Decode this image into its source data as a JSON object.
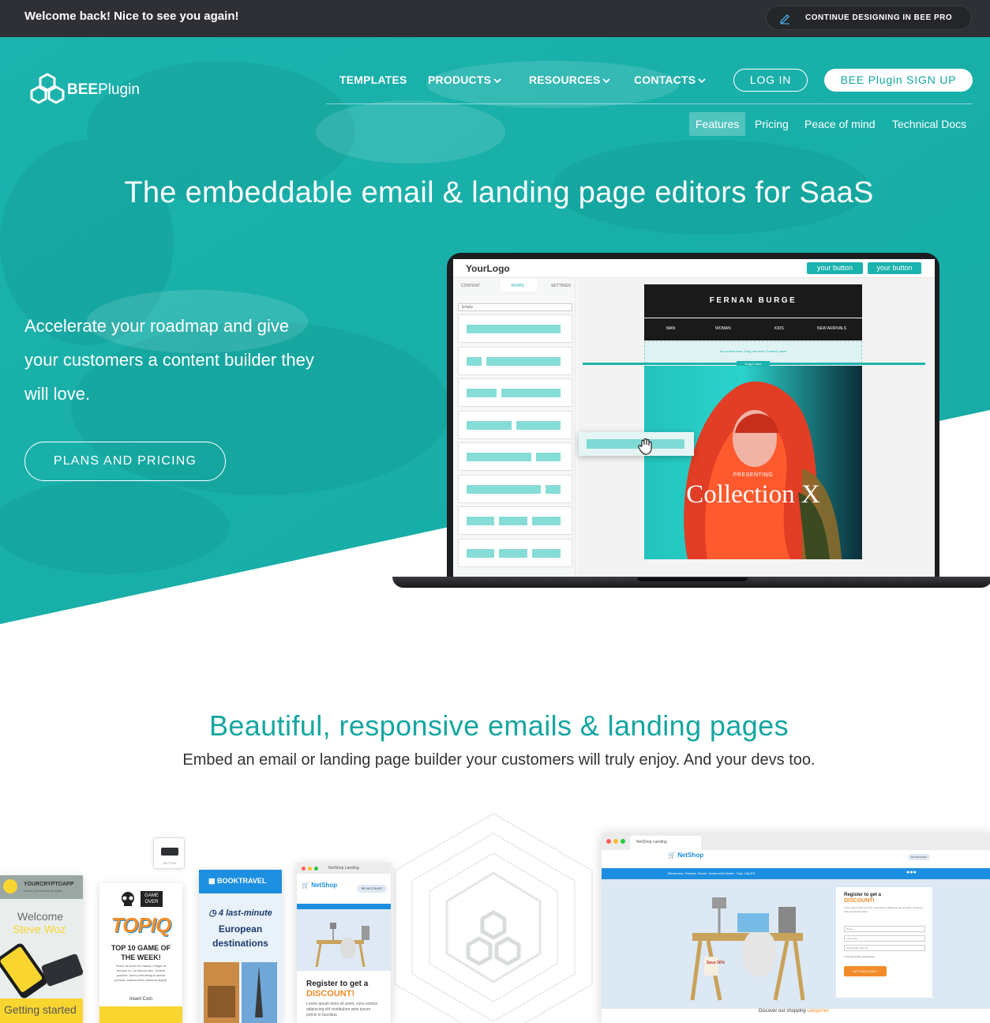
{
  "topbar": {
    "welcome": "Welcome back! Nice to see you again!",
    "continue_label": "CONTINUE DESIGNING IN BEE PRO"
  },
  "brand": {
    "logo_bold": "BEE",
    "logo_light": "Plugin"
  },
  "nav": {
    "items": [
      {
        "label": "TEMPLATES"
      },
      {
        "label": "PRODUCTS"
      },
      {
        "label": "RESOURCES"
      },
      {
        "label": "CONTACTS"
      }
    ],
    "login": "LOG IN",
    "signup": "BEE Plugin SIGN UP"
  },
  "subnav": [
    "Features",
    "Pricing",
    "Peace of mind",
    "Technical Docs"
  ],
  "hero": {
    "title": "The embeddable email & landing page editors for SaaS",
    "description": "Accelerate your roadmap and give your customers a content builder they will love.",
    "cta": "PLANS AND PRICING"
  },
  "editor_mock": {
    "your_logo": "YourLogo",
    "button1": "your button",
    "button2": "your button",
    "tabs": [
      "CONTENT",
      "ROWS",
      "SETTINGS"
    ],
    "dropdown": "Empty",
    "brand": "FERNAN BURGE",
    "menu": [
      "MAN",
      "WOMAN",
      "KIDS",
      "NEW ARRIVALS"
    ],
    "notice": "No content here. Drag new from 'Content' panel",
    "drop_label": "Drag it here",
    "presenting": "PRESENTING",
    "collection": "Collection X"
  },
  "section2": {
    "title": "Beautiful, responsive emails & landing pages",
    "subtitle": "Embed an email or landing page builder your customers will truly enjoy. And your devs too."
  },
  "templates": {
    "crypto": {
      "brand": "YOURCRYPTOAPP",
      "tag": "Lorem ipsum dolor sit amet",
      "welcome": "Welcome",
      "name": "Steve Woz",
      "cta": "Getting started"
    },
    "button_label": "BUTTON",
    "game": {
      "badge1": "GAME",
      "badge2": "OVER",
      "logo": "TOPIQ",
      "headline": "TOP 10 GAME OF THE WEEK!",
      "body": "Fusce at amet nis massa. Integer at tempus ex, ac blandit odio. Nullam pulvinar, tortor pellentesque lacinia pretium, massa tellus euismod augue.",
      "insert": "Insert Coin"
    },
    "travel": {
      "brand": "BOOKTRAVEL",
      "line1": "4 last-minute",
      "line2": "European",
      "line3": "destinations"
    },
    "netshop_small": {
      "tab": "NetShop Landing",
      "brand": "NetShop",
      "account": "MY ACCOUNT",
      "headline1": "Register to get a",
      "headline2": "DISCOUNT!",
      "body": "Lorem ipsum dolor sit amet, cons ectetur adipiscing elit vestibulum ante ipsum primis in faucibus."
    },
    "netshop_large": {
      "tab": "NetShop Landing",
      "brand": "NetShop",
      "account": "MY ACCOUNT",
      "nav": "Electronics  Fashion  Books  Home and Kitchen  Toys  SALES",
      "headline1": "Register to get a",
      "headline2": "DISCOUNT!",
      "body": "Lorem ipsum dolor sit amet, consectetur adipiscing elit, sed diam nonummy nibh euismod tincidunt.",
      "field1": "Name",
      "field2": "Last name",
      "field3": "example@email.com",
      "check": "Privacy Policy Acceptance",
      "cta": "GET DISCOUNT",
      "discover_prefix": "Discover our shopping ",
      "discover_highlight": "categories",
      "sale": "Save 50%"
    }
  },
  "colors": {
    "teal": "#14a6a0",
    "dark": "#2e3035",
    "orange": "#f28c28",
    "blue": "#1d8fe0",
    "yellow": "#f9d52f"
  }
}
